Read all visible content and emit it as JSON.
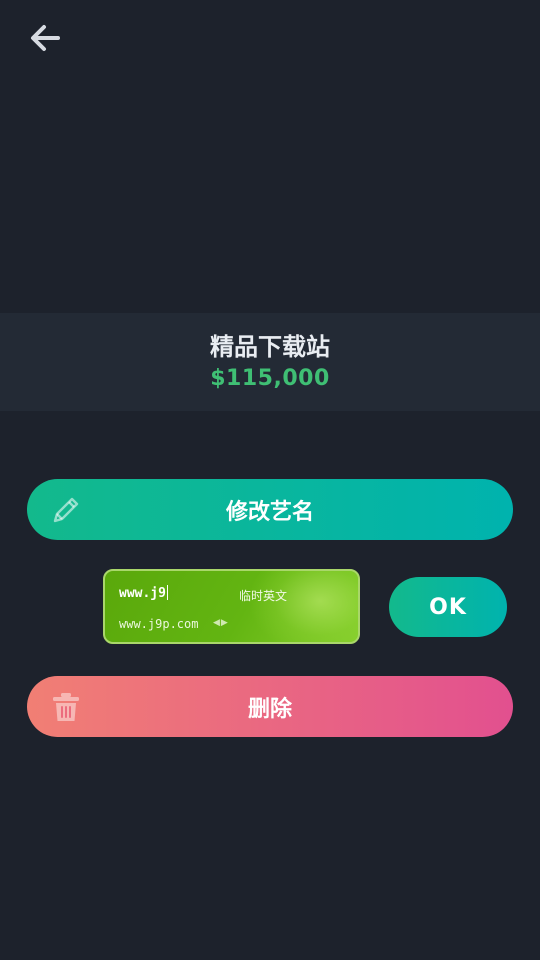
{
  "header": {
    "back_icon": "arrow-left-icon"
  },
  "item": {
    "name": "精品下载站",
    "price": "$115,000"
  },
  "actions": {
    "rename_label": "修改艺名",
    "rename_icon": "pencil-icon",
    "ok_label": "OK",
    "delete_label": "删除",
    "delete_icon": "trash-icon"
  },
  "ime": {
    "input_text": "www.j9",
    "mode_label": "临时英文",
    "candidate": "www.j9p.com"
  },
  "colors": {
    "background": "#1d222c",
    "band": "#232a35",
    "price": "#3fbf74",
    "teal_start": "#13b98c",
    "teal_end": "#00b3ae",
    "coral_start": "#f17f74",
    "pink_end": "#e2508f",
    "ime_green": "#5aa80b"
  }
}
